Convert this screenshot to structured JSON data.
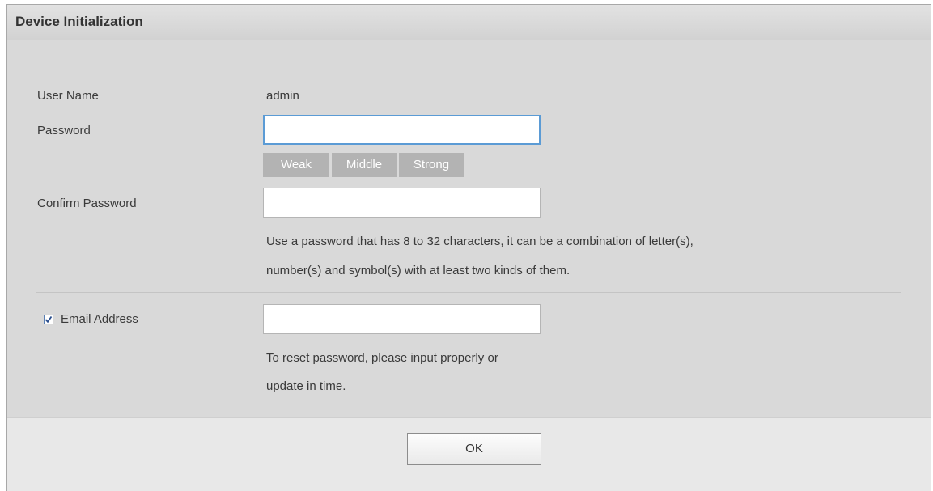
{
  "dialog": {
    "title": "Device Initialization"
  },
  "form": {
    "username_label": "User Name",
    "username_value": "admin",
    "password_label": "Password",
    "password_value": "",
    "strength": [
      "Weak",
      "Middle",
      "Strong"
    ],
    "confirm_label": "Confirm Password",
    "confirm_value": "",
    "password_hint_line1": "Use a password that has 8 to 32 characters, it can be a combination of letter(s),",
    "password_hint_line2": "number(s) and symbol(s) with at least two kinds of them.",
    "email_checked": true,
    "email_label": "Email Address",
    "email_value": "",
    "email_hint_line1": "To reset password, please input properly or",
    "email_hint_line2": "update in time."
  },
  "footer": {
    "ok_label": "OK"
  },
  "colors": {
    "focus_border": "#5b9bd5",
    "strength_bar": "#b3b3b3",
    "panel_bg": "#d9d9d9"
  }
}
